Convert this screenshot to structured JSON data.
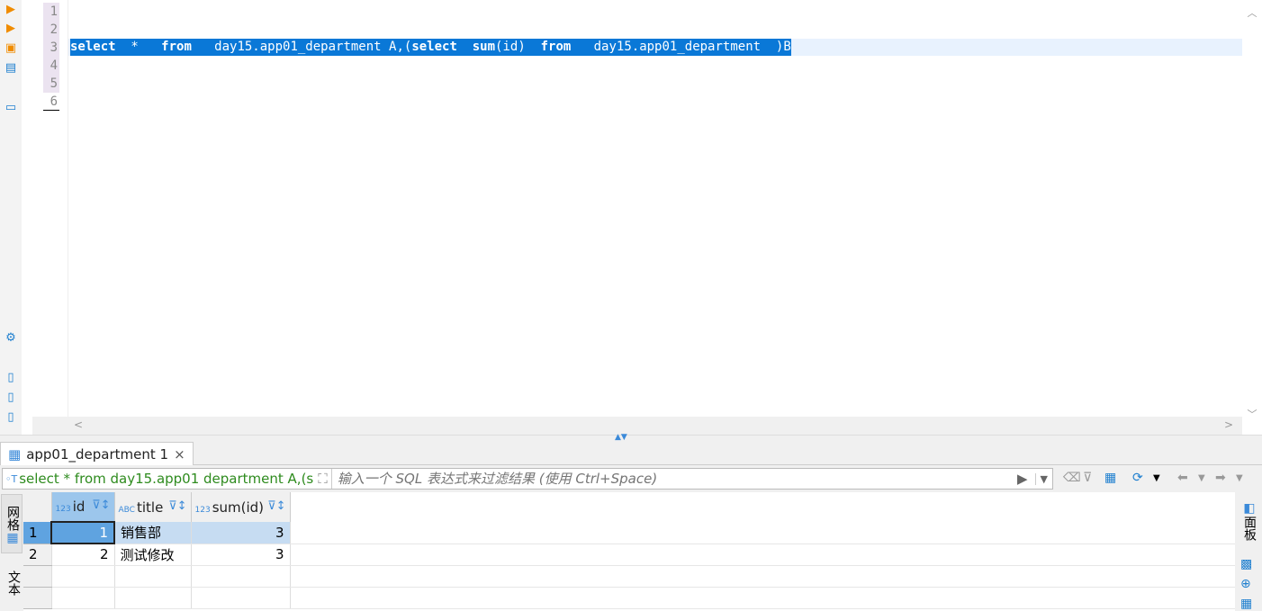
{
  "editor": {
    "line_numbers": [
      "1",
      "2",
      "3",
      "4",
      "5",
      "6"
    ],
    "selected_sql": "select  *   from   day15.app01_department A,(select  sum(id)  from   day15.app01_department  )B"
  },
  "results": {
    "tab_label": "app01_department 1",
    "query_text": "select * from day15.app01  department A,(se",
    "filter_placeholder": "输入一个 SQL 表达式来过滤结果 (使用 Ctrl+Space)",
    "columns": [
      {
        "name": "id",
        "type": "123"
      },
      {
        "name": "title",
        "type": "ABC"
      },
      {
        "name": "sum(id)",
        "type": "123"
      }
    ],
    "rows": [
      {
        "n": "1",
        "id": "1",
        "title": "销售部",
        "sum": "3"
      },
      {
        "n": "2",
        "id": "2",
        "title": "测试修改",
        "sum": "3"
      }
    ],
    "vtabs": {
      "grid": "网格",
      "text": "文本"
    },
    "right_panel": "面板"
  },
  "colors": {
    "selection": "#0a78d7",
    "accent": "#3b8ad9",
    "sql_text": "#2e8b1e"
  }
}
